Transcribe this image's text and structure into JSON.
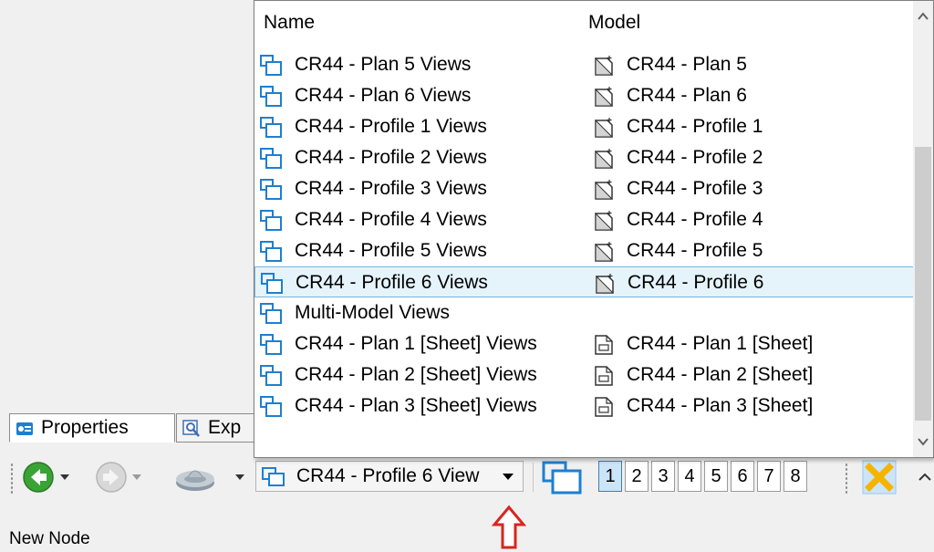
{
  "dropdown": {
    "header": {
      "name": "Name",
      "model": "Model"
    },
    "rows": [
      {
        "name": "CR44 - Plan 5 Views",
        "model": "CR44 - Plan 5",
        "model_icon": "design-model-icon"
      },
      {
        "name": "CR44 - Plan 6 Views",
        "model": "CR44 - Plan 6",
        "model_icon": "design-model-icon"
      },
      {
        "name": "CR44 - Profile 1 Views",
        "model": "CR44 - Profile 1",
        "model_icon": "design-model-icon"
      },
      {
        "name": "CR44 - Profile 2 Views",
        "model": "CR44 - Profile 2",
        "model_icon": "design-model-icon"
      },
      {
        "name": "CR44 - Profile 3 Views",
        "model": "CR44 - Profile 3",
        "model_icon": "design-model-icon"
      },
      {
        "name": "CR44 - Profile 4 Views",
        "model": "CR44 - Profile 4",
        "model_icon": "design-model-icon"
      },
      {
        "name": "CR44 - Profile 5 Views",
        "model": "CR44 - Profile 5",
        "model_icon": "design-model-icon"
      },
      {
        "name": "CR44 - Profile 6 Views",
        "model": "CR44 - Profile 6",
        "model_icon": "design-model-icon",
        "selected": true
      },
      {
        "name": "Multi-Model Views",
        "model": "",
        "model_icon": ""
      },
      {
        "name": "CR44 - Plan 1 [Sheet] Views",
        "model": "CR44 - Plan 1 [Sheet]",
        "model_icon": "sheet-model-icon"
      },
      {
        "name": "CR44 - Plan 2 [Sheet] Views",
        "model": "CR44 - Plan 2 [Sheet]",
        "model_icon": "sheet-model-icon"
      },
      {
        "name": "CR44 - Plan 3 [Sheet] Views",
        "model": "CR44 - Plan 3 [Sheet]",
        "model_icon": "sheet-model-icon"
      }
    ]
  },
  "tabs": {
    "properties": "Properties",
    "explorer": "Exp"
  },
  "toolbar": {
    "current_view": "CR44 - Profile 6 View",
    "view_numbers": [
      "1",
      "2",
      "3",
      "4",
      "5",
      "6",
      "7",
      "8"
    ],
    "active_view_number": "1"
  },
  "status": {
    "text": "New Node"
  },
  "colors": {
    "accent_blue": "#1e7fd0",
    "selection_bg": "#e5f3fb",
    "back_green": "#3aa335",
    "pointer_red": "#d7261e",
    "close_orange": "#f5b400"
  }
}
